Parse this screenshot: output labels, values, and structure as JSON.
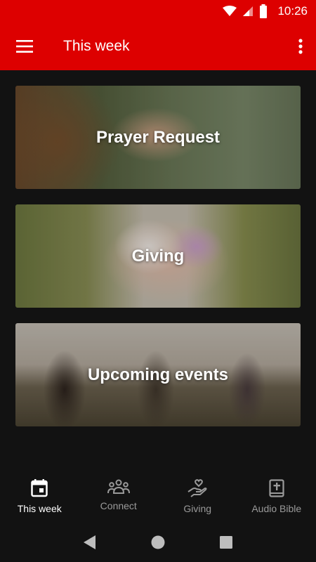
{
  "status_bar": {
    "time": "10:26"
  },
  "app_bar": {
    "title": "This week"
  },
  "cards": [
    {
      "label": "Prayer Request"
    },
    {
      "label": "Giving"
    },
    {
      "label": "Upcoming events"
    }
  ],
  "bottom_nav": {
    "items": [
      {
        "label": "This week",
        "icon": "calendar-icon",
        "active": true
      },
      {
        "label": "Connect",
        "icon": "group-icon",
        "active": false
      },
      {
        "label": "Giving",
        "icon": "hand-heart-icon",
        "active": false
      },
      {
        "label": "Audio Bible",
        "icon": "bible-icon",
        "active": false
      }
    ]
  },
  "colors": {
    "primary": "#dd0000",
    "background": "#121212",
    "nav_inactive": "#9a9a9a"
  }
}
